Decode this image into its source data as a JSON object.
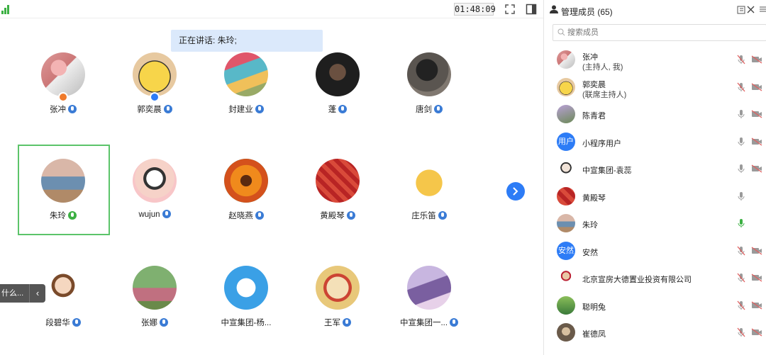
{
  "meeting": {
    "timer": "01:48:09",
    "speaking_banner": "正在讲话: 朱玲;",
    "chat_preview": "什么..."
  },
  "colors": {
    "accent": "#2d7cf6",
    "speaking_border": "#5cc46a",
    "muted_red": "#e06060",
    "live_green": "#3cb043"
  },
  "grid": [
    {
      "name": "张冲",
      "mic": "blue",
      "badge": "host"
    },
    {
      "name": "郭奕晨",
      "mic": "blue",
      "badge": "cohost"
    },
    {
      "name": "封建业",
      "mic": "blue"
    },
    {
      "name": "蓬",
      "mic": "blue"
    },
    {
      "name": "唐剑",
      "mic": "blue"
    },
    {
      "name": "朱玲",
      "mic": "green",
      "selected": true
    },
    {
      "name": "wujun",
      "mic": "blue"
    },
    {
      "name": "赵晓燕",
      "mic": "blue"
    },
    {
      "name": "黄殿琴",
      "mic": "blue"
    },
    {
      "name": "庄乐笛",
      "mic": "blue"
    },
    {
      "name": "段碧华",
      "mic": "blue"
    },
    {
      "name": "张娜",
      "mic": "blue"
    },
    {
      "name": "中宣集团-杨...",
      "mic": "none"
    },
    {
      "name": "王军",
      "mic": "blue"
    },
    {
      "name": "中宣集团一...",
      "mic": "blue"
    }
  ],
  "panel": {
    "title": "管理成员 (65)",
    "search_placeholder": "搜索成员",
    "members": [
      {
        "name": "张冲",
        "role": "(主持人, 我)",
        "mic": "muted",
        "cam": "off"
      },
      {
        "name": "郭奕晨",
        "role": "(联席主持人)",
        "mic": "muted",
        "cam": "off"
      },
      {
        "name": "陈青君",
        "mic": "on",
        "cam": "off"
      },
      {
        "name": "小程序用户",
        "avatar_text": "用户",
        "mic": "on",
        "cam": "off"
      },
      {
        "name": "中宣集团-袁蕊",
        "mic": "on",
        "cam": "off"
      },
      {
        "name": "黄殿琴",
        "mic": "on",
        "cam": "none"
      },
      {
        "name": "朱玲",
        "mic": "speaking",
        "cam": "none"
      },
      {
        "name": "安然",
        "avatar_text": "安然",
        "mic": "muted",
        "cam": "off"
      },
      {
        "name": "北京宣房大德置业投资有限公司",
        "mic": "muted",
        "cam": "off"
      },
      {
        "name": "聪明兔",
        "mic": "muted",
        "cam": "off"
      },
      {
        "name": "崔德凤",
        "mic": "muted",
        "cam": "off"
      }
    ]
  }
}
